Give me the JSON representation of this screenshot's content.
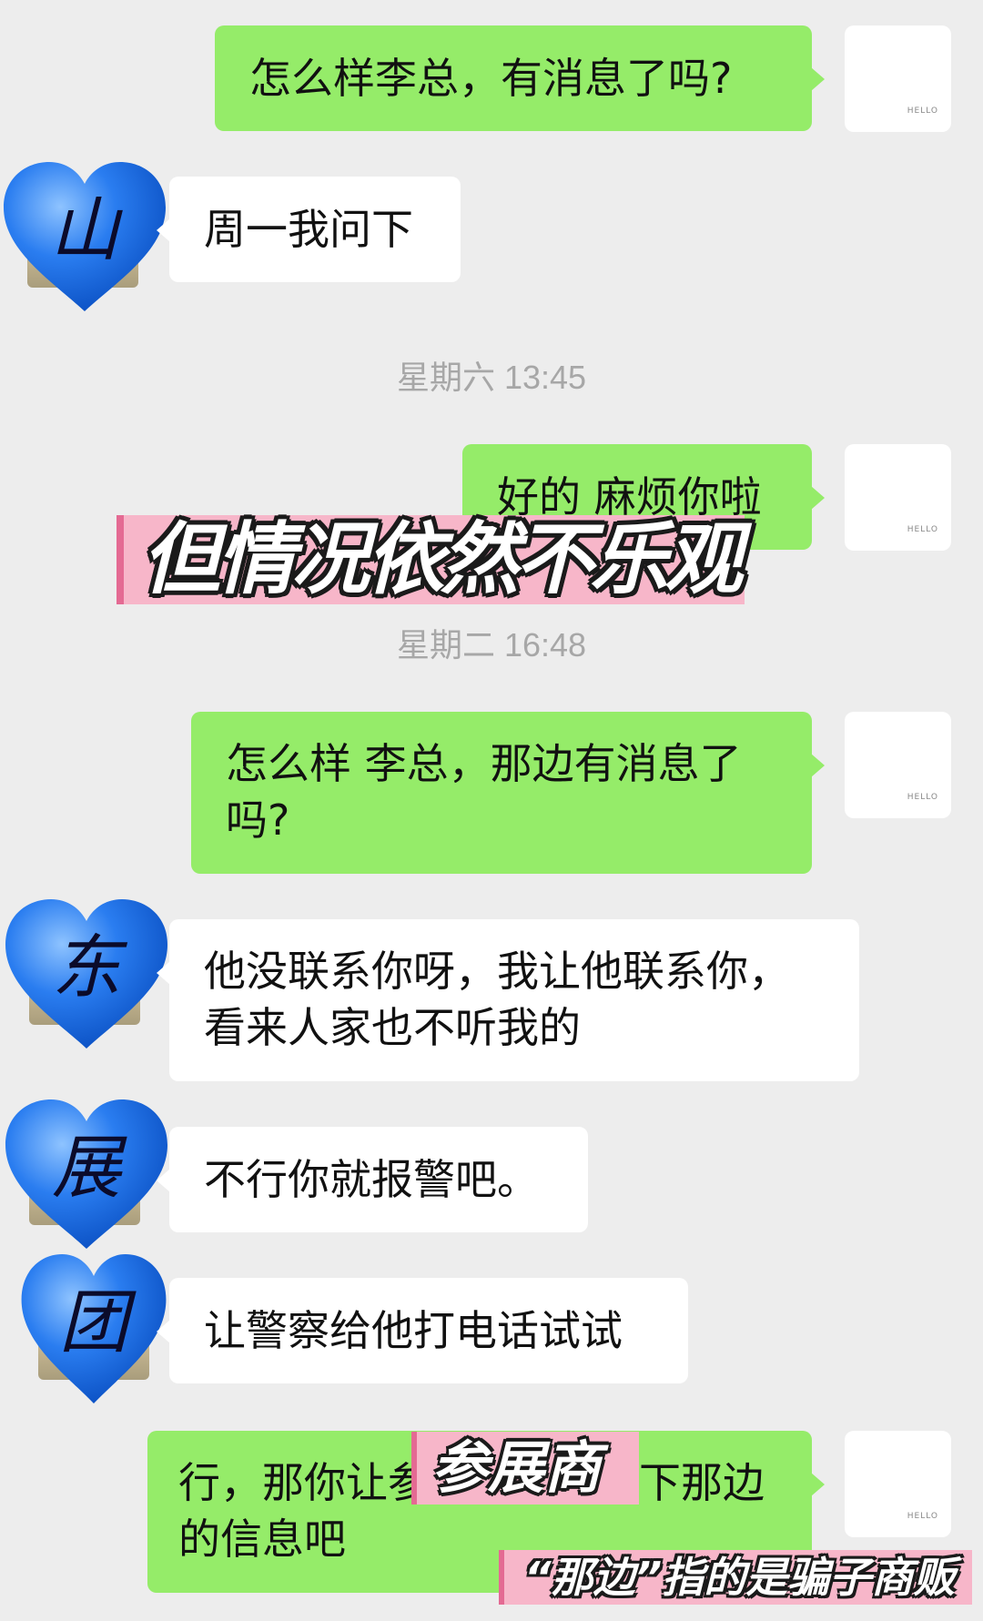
{
  "messages": {
    "m1": "怎么样李总，有消息了吗?",
    "m2": "周一我问下",
    "m3": "好的 麻烦你啦",
    "m4": "怎么样 李总，那边有消息了吗?",
    "m5": "他没联系你呀，我让他联系你，看来人家也不听我的",
    "m6": "不行你就报警吧。",
    "m7": "让警察给他打电话试试",
    "m8": "行，那你让参展商提供一下那边的信息吧"
  },
  "timestamps": {
    "t1": "星期六 13:45",
    "t2": "星期二 16:48"
  },
  "avatars": {
    "my_avatar_text": "HELLO",
    "heart1": "山",
    "heart2": "东",
    "heart3": "展",
    "heart4": "团",
    "heart_color": "#1f6fe8"
  },
  "captions": {
    "big": "但情况依然不乐观",
    "mid": "参展商",
    "small": "“那边”指的是骗子商贩"
  },
  "colors": {
    "sent_bubble": "#95ec69",
    "recv_bubble": "#ffffff",
    "background": "#ededed",
    "caption_bg": "#f7b6c9"
  }
}
